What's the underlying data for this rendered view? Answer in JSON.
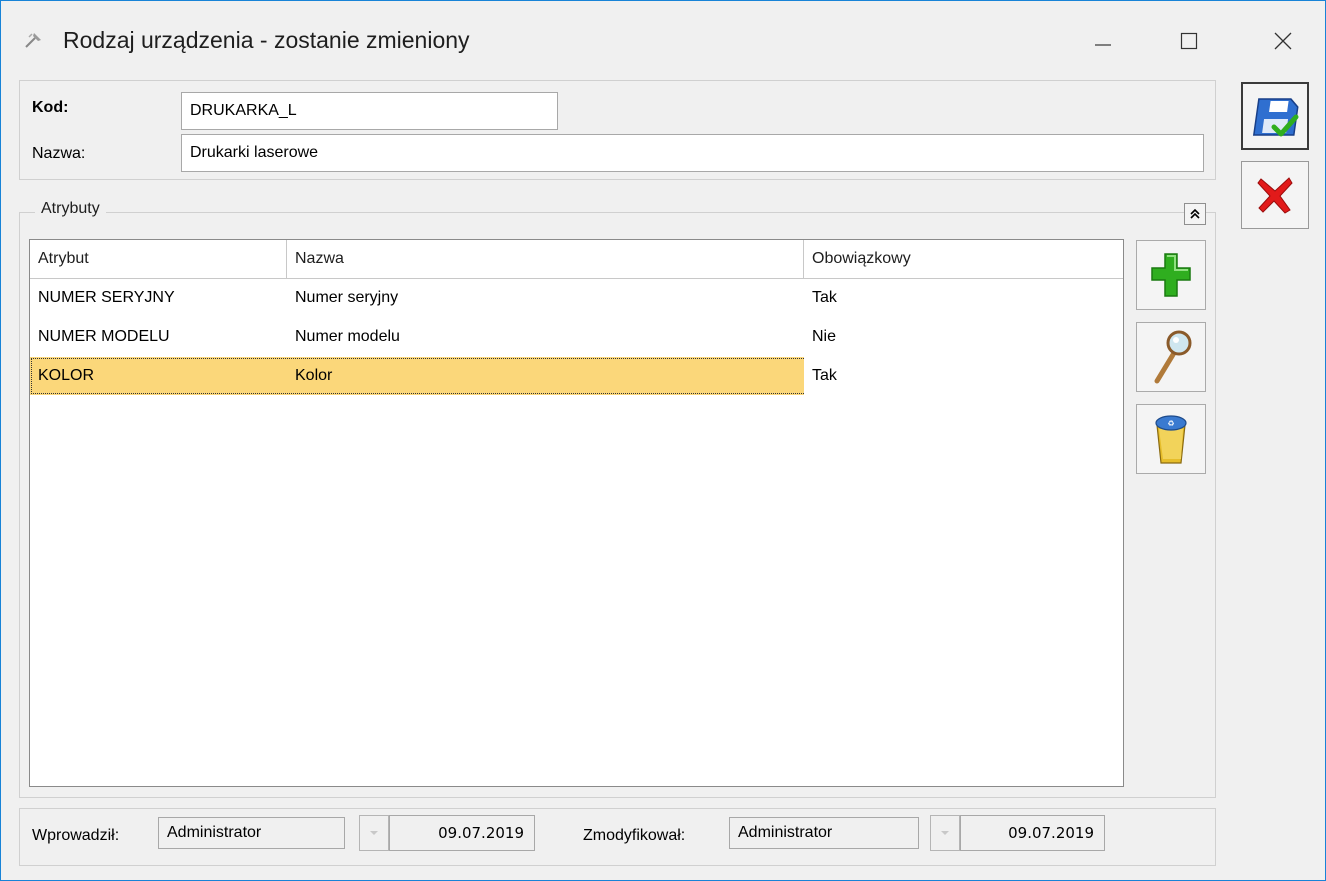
{
  "window": {
    "title": "Rodzaj urządzenia - zostanie zmieniony"
  },
  "form": {
    "kod_label": "Kod:",
    "kod_value": "DRUKARKA_L",
    "nazwa_label": "Nazwa:",
    "nazwa_value": "Drukarki laserowe"
  },
  "attributes": {
    "group_label": "Atrybuty",
    "columns": [
      "Atrybut",
      "Nazwa",
      "Obowiązkowy"
    ],
    "rows": [
      {
        "atrybut": "NUMER SERYJNY",
        "nazwa": "Numer seryjny",
        "obowiazkowy": "Tak"
      },
      {
        "atrybut": "NUMER MODELU",
        "nazwa": "Numer modelu",
        "obowiazkowy": "Nie"
      },
      {
        "atrybut": "KOLOR",
        "nazwa": "Kolor",
        "obowiazkowy": "Tak"
      }
    ],
    "selected_row": 2
  },
  "footer": {
    "wprowadzil_label": "Wprowadził:",
    "wprowadzil_user": "Administrator",
    "wprowadzil_date": "09.07.2019",
    "zmodyfikowal_label": "Zmodyfikował:",
    "zmodyfikowal_user": "Administrator",
    "zmodyfikowal_date": "09.07.2019"
  },
  "icons": {
    "title": "wrench-icon",
    "save": "save-floppy-check-icon",
    "cancel": "cancel-x-icon",
    "add": "add-plus-icon",
    "edit": "magnifier-icon",
    "delete": "trash-bin-icon",
    "collapse": "double-chevron-up-icon"
  },
  "colors": {
    "selected_row": "#fbd77a",
    "window_border": "#1883d7",
    "add_green": "#2fae1f",
    "cancel_red": "#e21a1a"
  }
}
